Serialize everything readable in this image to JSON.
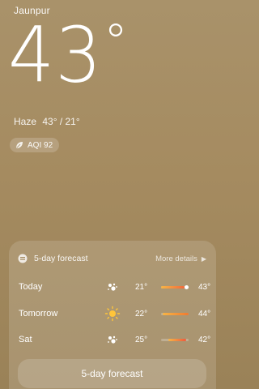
{
  "location": {
    "city": "Jaunpur"
  },
  "current": {
    "temperature": "43",
    "degree_symbol": "°",
    "condition": "Haze",
    "high_low": "43° / 21°"
  },
  "aqi": {
    "label": "AQI 92",
    "icon": "leaf-icon"
  },
  "forecast": {
    "header": "5-day forecast",
    "more_details": "More details",
    "days": [
      {
        "day": "Today",
        "icon": "haze-night-icon",
        "low": "21°",
        "high": "43°",
        "range_from": 0.0,
        "range_to": 0.85,
        "current_marker": 0.92,
        "fill_color": "#f26a3a"
      },
      {
        "day": "Tomorrow",
        "icon": "sunny-icon",
        "low": "22°",
        "high": "44°",
        "range_from": 0.05,
        "range_to": 1.0,
        "fill_color": "#f07a30"
      },
      {
        "day": "Sat",
        "icon": "haze-night-icon",
        "low": "25°",
        "high": "42°",
        "range_from": 0.25,
        "range_to": 0.92,
        "fill_color": "#ef5a3c"
      }
    ],
    "button_label": "5-day forecast"
  },
  "colors": {
    "background_top": "#a9926a",
    "background_bottom": "#9a8258",
    "sun": "#ffc53a"
  }
}
